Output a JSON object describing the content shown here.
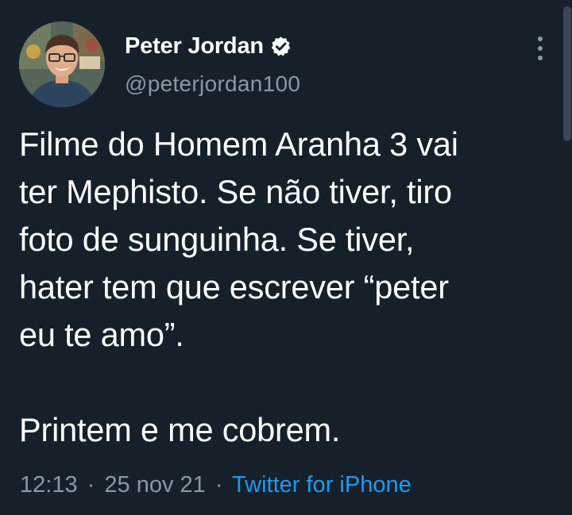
{
  "author": {
    "display_name": "Peter Jordan",
    "handle": "@peterjordan100",
    "verified": true,
    "avatar_icon": "profile-photo",
    "verified_icon": "verified-badge-icon"
  },
  "tweet": {
    "paragraphs": [
      "Filme do Homem Aranha 3 vai\nter Mephisto. Se não tiver, tiro\nfoto de sunguinha. Se tiver,\nhater tem que escrever “peter\neu te amo”.",
      "Printem e me cobrem."
    ],
    "time": "12:13",
    "separator": "·",
    "date": "25 nov 21",
    "source": "Twitter for iPhone"
  },
  "menu": {
    "icon": "more-options-icon"
  },
  "colors": {
    "background": "#15202b",
    "text": "#ffffff",
    "secondary": "#8899a6",
    "accent": "#1d9bf0"
  }
}
